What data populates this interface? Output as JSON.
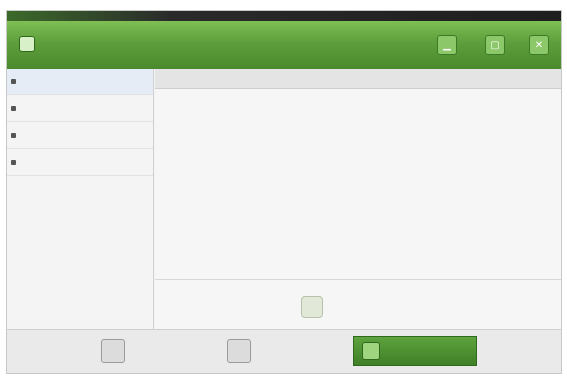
{
  "window": {
    "title": ""
  },
  "titlebar_buttons": [
    {
      "name": "minimize-button",
      "glyph": "▁"
    },
    {
      "name": "maximize-button",
      "glyph": "▢"
    },
    {
      "name": "close-button",
      "glyph": "✕"
    }
  ],
  "sidebar": {
    "items": [
      {
        "label": "",
        "active": true
      },
      {
        "label": ""
      },
      {
        "label": ""
      },
      {
        "label": ""
      }
    ]
  },
  "content": {
    "section_title": "",
    "paragraph_1": "",
    "paragraph_2": "",
    "checkbox_label": ""
  },
  "footer": {
    "back_label": "",
    "cancel_label": "",
    "next_label": ""
  },
  "colors": {
    "titlebar_green": "#5e9e3c",
    "primary_button_green": "#3f7f27",
    "sidebar_active": "#e6ecf5"
  }
}
